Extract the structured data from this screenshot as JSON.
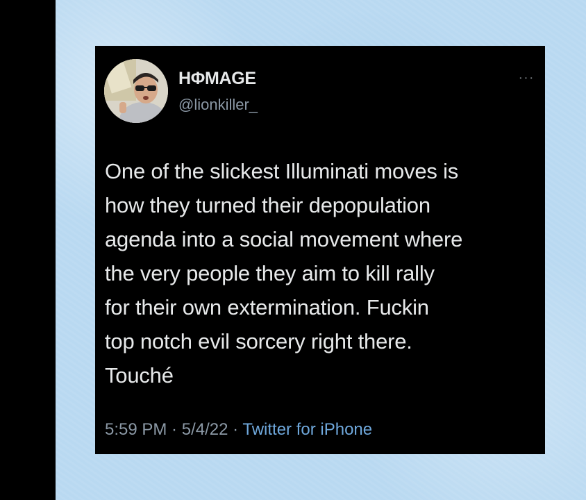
{
  "tweet": {
    "display_name": "HΦMAGE",
    "handle": "@lionkiller_",
    "text": "One of the slickest Illuminati moves is\nhow they turned their depopulation\nagenda into a social movement where\nthe very people they aim to kill rally\nfor their own extermination. Fuckin\ntop notch evil sorcery right there.\nTouché",
    "time": "5:59 PM",
    "separator": " · ",
    "date": "5/4/22",
    "source": "Twitter for iPhone",
    "more_icon": "more-horizontal-icon"
  },
  "colors": {
    "background": "#b9d9f1",
    "card": "#000000",
    "text": "#e7e9ea",
    "secondary_text": "#8b98a5",
    "link": "#6fa8dc"
  }
}
